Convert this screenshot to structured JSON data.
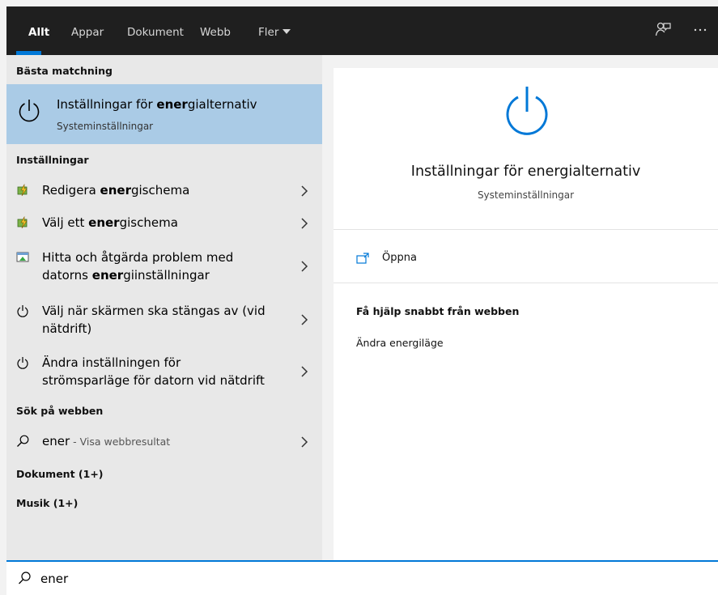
{
  "tabs": [
    {
      "label": "Allt",
      "active": true
    },
    {
      "label": "Appar"
    },
    {
      "label": "Dokument"
    },
    {
      "label": "Webb"
    },
    {
      "label": "Fler"
    }
  ],
  "sections": {
    "best_match": "Bästa matchning",
    "settings": "Inställningar",
    "web": "Sök på webben",
    "documents": "Dokument (1+)",
    "music": "Musik (1+)"
  },
  "best_match": {
    "title_pre": "Inställningar för ",
    "title_bold": "ener",
    "title_post": "gialternativ",
    "subtitle": "Systeminställningar"
  },
  "settings_items": [
    {
      "pre": "Redigera ",
      "bold": "ener",
      "post": "gischema",
      "icon": "power-plan-icon"
    },
    {
      "pre": "Välj ett ",
      "bold": "ener",
      "post": "gischema",
      "icon": "power-plan-icon"
    },
    {
      "line1": "Hitta och åtgärda problem med",
      "line2_pre": "datorns ",
      "line2_bold": "ener",
      "line2_post": "giinställningar",
      "icon": "troubleshoot-icon"
    },
    {
      "line1": "Välj när skärmen ska stängas av (vid",
      "line2": "nätdrift)",
      "icon": "power-icon"
    },
    {
      "line1": "Ändra inställningen för",
      "line2": "strömsparläge för datorn vid nätdrift",
      "icon": "power-icon"
    }
  ],
  "web_item": {
    "query": "ener",
    "suffix": " - Visa webbresultat"
  },
  "preview": {
    "title": "Inställningar för energialternativ",
    "subtitle": "Systeminställningar",
    "open_label": "Öppna",
    "help_title": "Få hjälp snabbt från webben",
    "help_link": "Ändra energiläge"
  },
  "search": {
    "value": "ener"
  },
  "colors": {
    "accent": "#0078d7",
    "selected": "#aacbe6",
    "topbar": "#1f1f1f",
    "left_bg": "#e8e8e8"
  }
}
